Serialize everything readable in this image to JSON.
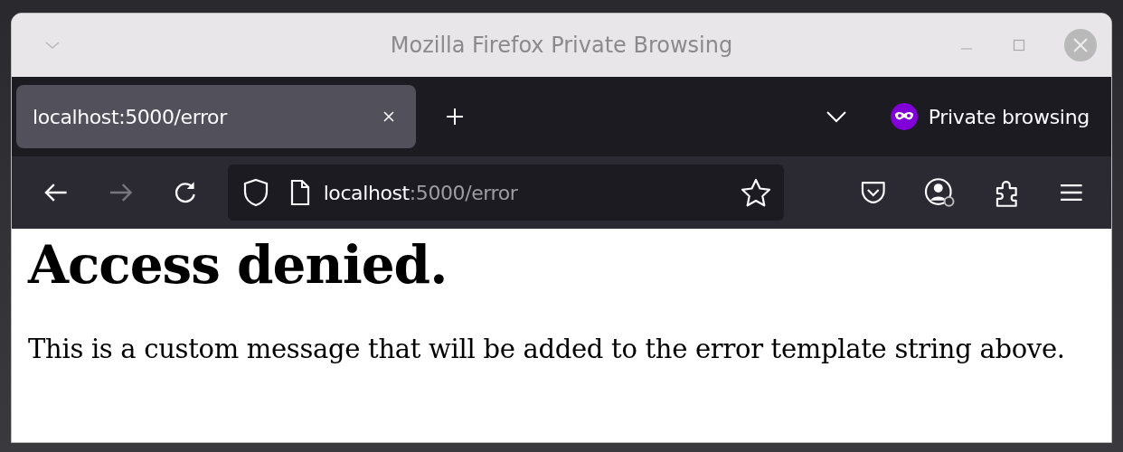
{
  "window": {
    "title": "Mozilla Firefox Private Browsing"
  },
  "tabs": [
    {
      "label": "localhost:5000/error",
      "selected": true
    }
  ],
  "private_indicator": {
    "label": "Private browsing"
  },
  "nav": {
    "back_disabled": false,
    "forward_disabled": true
  },
  "url": {
    "host": "localhost",
    "rest": ":5000/error"
  },
  "page": {
    "heading": "Access denied.",
    "message": "This is a custom message that will be added to the error template string above."
  }
}
